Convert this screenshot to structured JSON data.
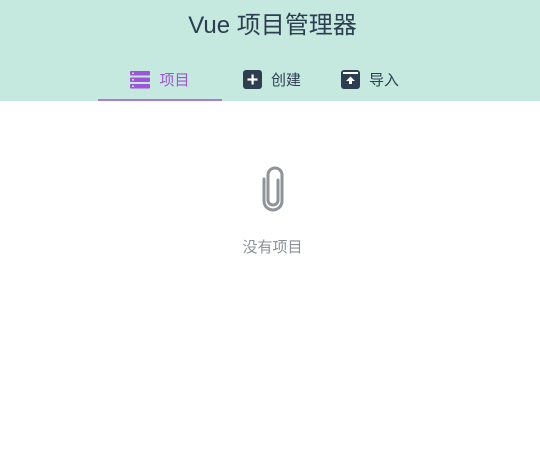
{
  "header": {
    "title": "Vue 项目管理器",
    "background": "#c6e9df"
  },
  "tabs": [
    {
      "label": "项目",
      "icon": "list-icon",
      "active": true
    },
    {
      "label": "创建",
      "icon": "plus-square-icon",
      "active": false
    },
    {
      "label": "导入",
      "icon": "import-box-icon",
      "active": false
    }
  ],
  "accent_color": "#9d54d9",
  "main": {
    "empty_icon": "paperclip-icon",
    "empty_text": "没有项目"
  }
}
